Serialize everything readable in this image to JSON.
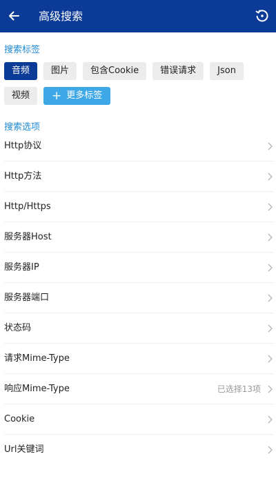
{
  "header": {
    "title": "高级搜索",
    "back_icon": "arrow-left-icon",
    "reset_icon": "history-reset-icon"
  },
  "tags_section": {
    "title": "搜索标签",
    "tags": [
      {
        "label": "音频",
        "selected": true
      },
      {
        "label": "图片",
        "selected": false
      },
      {
        "label": "包含Cookie",
        "selected": false
      },
      {
        "label": "错误请求",
        "selected": false
      },
      {
        "label": "Json",
        "selected": false
      },
      {
        "label": "视频",
        "selected": false
      }
    ],
    "more_button": {
      "plus": "+",
      "label": "更多标签"
    }
  },
  "options_section": {
    "title": "搜索选项",
    "items": [
      {
        "label": "Http协议",
        "value": ""
      },
      {
        "label": "Http方法",
        "value": ""
      },
      {
        "label": "Http/Https",
        "value": ""
      },
      {
        "label": "服务器Host",
        "value": ""
      },
      {
        "label": "服务器IP",
        "value": ""
      },
      {
        "label": "服务器端口",
        "value": ""
      },
      {
        "label": "状态码",
        "value": ""
      },
      {
        "label": "请求Mime-Type",
        "value": ""
      },
      {
        "label": "响应Mime-Type",
        "value": "已选择13项"
      },
      {
        "label": "Cookie",
        "value": ""
      },
      {
        "label": "Url关键词",
        "value": ""
      }
    ]
  },
  "colors": {
    "primary": "#0b3a97",
    "accent": "#3ea7e6",
    "section_title": "#1f8bd6"
  }
}
